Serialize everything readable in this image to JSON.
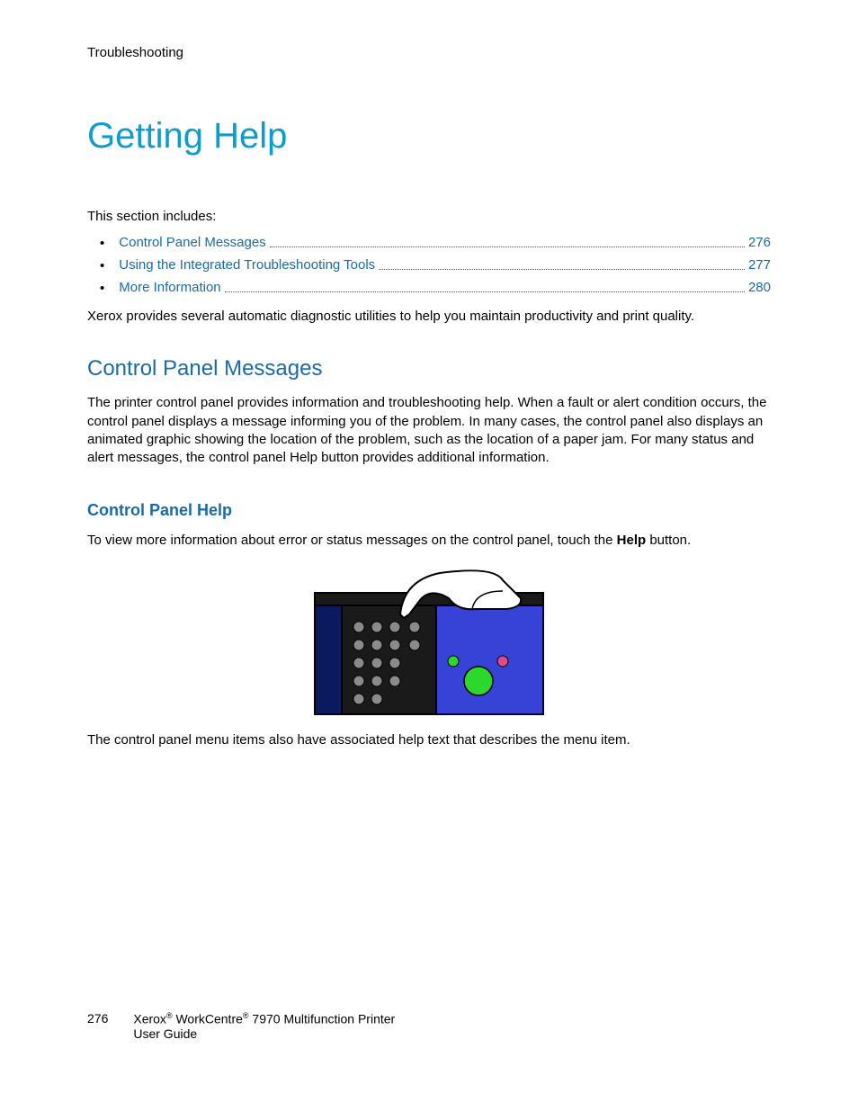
{
  "header": {
    "section": "Troubleshooting"
  },
  "title": "Getting Help",
  "intro": "This section includes:",
  "toc": [
    {
      "label": "Control Panel Messages",
      "page": "276"
    },
    {
      "label": "Using the Integrated Troubleshooting Tools",
      "page": "277"
    },
    {
      "label": "More Information",
      "page": "280"
    }
  ],
  "para_diag": "Xerox provides several automatic diagnostic utilities to help you maintain productivity and print quality.",
  "h2_cpm": "Control Panel Messages",
  "para_cpm": "The printer control panel provides information and troubleshooting help. When a fault or alert condition occurs, the control panel displays a message informing you of the problem. In many cases, the control panel also displays an animated graphic showing the location of the problem, such as the location of a paper jam. For many status and alert messages, the control panel Help button provides additional information.",
  "h3_cph": "Control Panel Help",
  "para_cph_pre": "To view more information about error or status messages on the control panel, touch the ",
  "para_cph_bold": "Help",
  "para_cph_post": " button.",
  "para_menu": "The control panel menu items also have associated help text that describes the menu item.",
  "footer": {
    "page": "276",
    "brand1": "Xerox",
    "brand2": " WorkCentre",
    "brand3": " 7970 Multifunction Printer",
    "line2": "User Guide"
  }
}
